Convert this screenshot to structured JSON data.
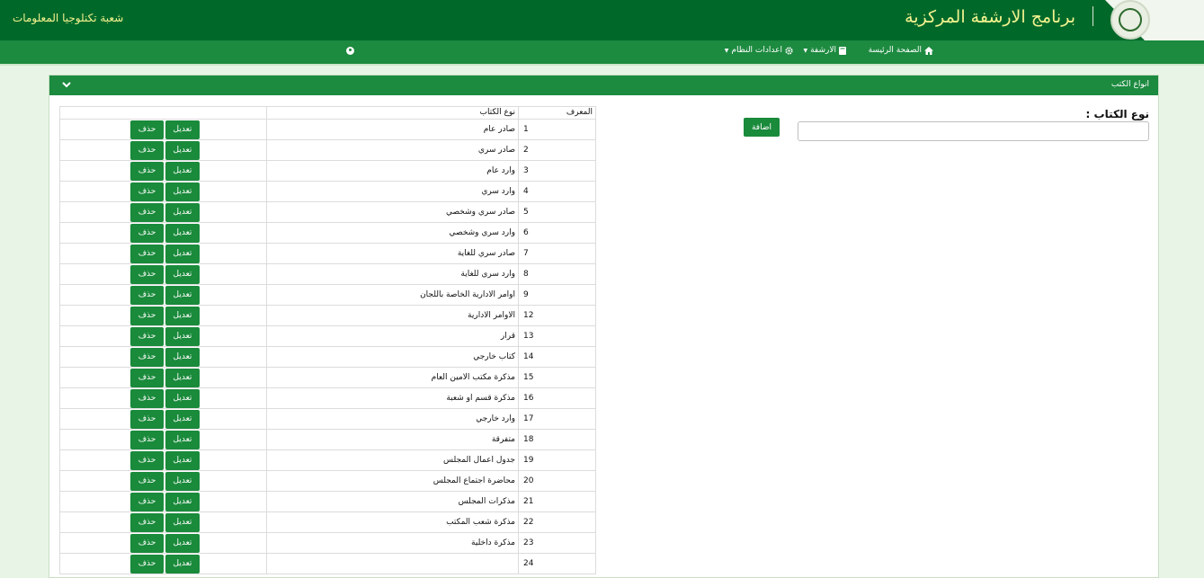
{
  "header": {
    "app_title": "برنامج الارشفة المركزية",
    "department": "شعبة تكنلوجيا المعلومات"
  },
  "nav": {
    "home": "الصفحة الرئيسة",
    "archive": "الارشفة",
    "settings": "اعدادات النظام"
  },
  "panel": {
    "title": "انواع الكتب"
  },
  "form": {
    "label": "نوع الكتاب :",
    "input_value": "",
    "add_button": "اضافة"
  },
  "table": {
    "headers": {
      "id": "المعرف",
      "name": "نوع الكتاب",
      "actions": ""
    },
    "edit_label": "تعديل",
    "delete_label": "حذف",
    "rows": [
      {
        "id": "1",
        "name": "صادر عام"
      },
      {
        "id": "2",
        "name": "صادر سري"
      },
      {
        "id": "3",
        "name": "وارد عام"
      },
      {
        "id": "4",
        "name": "وارد سري"
      },
      {
        "id": "5",
        "name": "صادر سري وشخصي"
      },
      {
        "id": "6",
        "name": "وارد سري وشخصي"
      },
      {
        "id": "7",
        "name": "صادر سري للغاية"
      },
      {
        "id": "8",
        "name": "وارد سري للغاية"
      },
      {
        "id": "9",
        "name": "اوامر الادارية الخاصة باللجان"
      },
      {
        "id": "12",
        "name": "الاوامر الادارية"
      },
      {
        "id": "13",
        "name": "قرار"
      },
      {
        "id": "14",
        "name": "كتاب خارجي"
      },
      {
        "id": "15",
        "name": "مذكرة مكتب الامين العام"
      },
      {
        "id": "16",
        "name": "مذكرة قسم او شعبة"
      },
      {
        "id": "17",
        "name": "وارد خارجي"
      },
      {
        "id": "18",
        "name": "متفرقة"
      },
      {
        "id": "19",
        "name": "جدول اعمال المجلس"
      },
      {
        "id": "20",
        "name": "محاضرة اجتماع المجلس"
      },
      {
        "id": "21",
        "name": "مذكرات المجلس"
      },
      {
        "id": "22",
        "name": "مذكرة شعب المكتب"
      },
      {
        "id": "23",
        "name": "مذكرة داخلية"
      },
      {
        "id": "24",
        "name": ""
      }
    ]
  },
  "colors": {
    "topbar": "#00692a",
    "navbar": "#1c8a3f",
    "button": "#1a8a3b",
    "title_text": "#f5f38f"
  },
  "icons": {
    "home": "home-icon",
    "archive": "book-icon",
    "settings": "gear-icon",
    "user": "user-circle-icon",
    "collapse": "chevron-down-icon"
  }
}
